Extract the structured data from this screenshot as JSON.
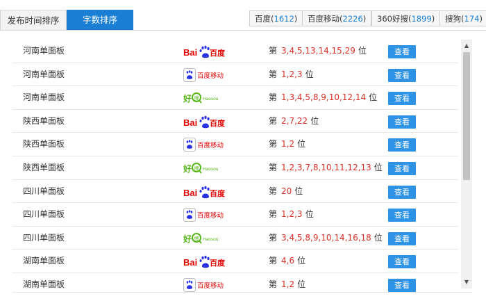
{
  "tabs": [
    {
      "label": "发布时间排序"
    },
    {
      "label": "字数排序"
    }
  ],
  "engines": [
    {
      "label": "百度(",
      "count": "1612",
      "suffix": ")"
    },
    {
      "label": "百度移动(",
      "count": "2226",
      "suffix": ")"
    },
    {
      "label": "360好搜(",
      "count": "1899",
      "suffix": ")"
    },
    {
      "label": "搜狗(",
      "count": "174",
      "suffix": ")"
    }
  ],
  "rank_prefix": "第",
  "rank_suffix": "位",
  "view_label": "查看",
  "logos": {
    "baidu": {
      "text": "Bai百度",
      "icon": "baidu-paw-icon"
    },
    "baidu_mobile": {
      "text": "百度移动",
      "icon": "baidu-mobile-icon"
    },
    "haosou": {
      "text": "好搜 Haosou",
      "icon": "haosou-icon"
    }
  },
  "rows": [
    {
      "region": "河南单面板",
      "engine": "baidu",
      "positions": "3,4,5,13,14,15,29"
    },
    {
      "region": "河南单面板",
      "engine": "baidu_mobile",
      "positions": "1,2,3"
    },
    {
      "region": "河南单面板",
      "engine": "haosou",
      "positions": "1,3,4,5,8,9,10,12,14"
    },
    {
      "region": "陕西单面板",
      "engine": "baidu",
      "positions": "2,7,22"
    },
    {
      "region": "陕西单面板",
      "engine": "baidu_mobile",
      "positions": "1,2"
    },
    {
      "region": "陕西单面板",
      "engine": "haosou",
      "positions": "1,2,3,7,8,10,11,12,13"
    },
    {
      "region": "四川单面板",
      "engine": "baidu",
      "positions": "20"
    },
    {
      "region": "四川单面板",
      "engine": "baidu_mobile",
      "positions": "1,2,3"
    },
    {
      "region": "四川单面板",
      "engine": "haosou",
      "positions": "3,4,5,8,9,10,14,16,18"
    },
    {
      "region": "湖南单面板",
      "engine": "baidu",
      "positions": "4,6"
    },
    {
      "region": "湖南单面板",
      "engine": "baidu_mobile",
      "positions": "1,2"
    }
  ],
  "colors": {
    "accent": "#1a7fd4",
    "button": "#2f93e5",
    "rank_numbers": "#d93025"
  }
}
